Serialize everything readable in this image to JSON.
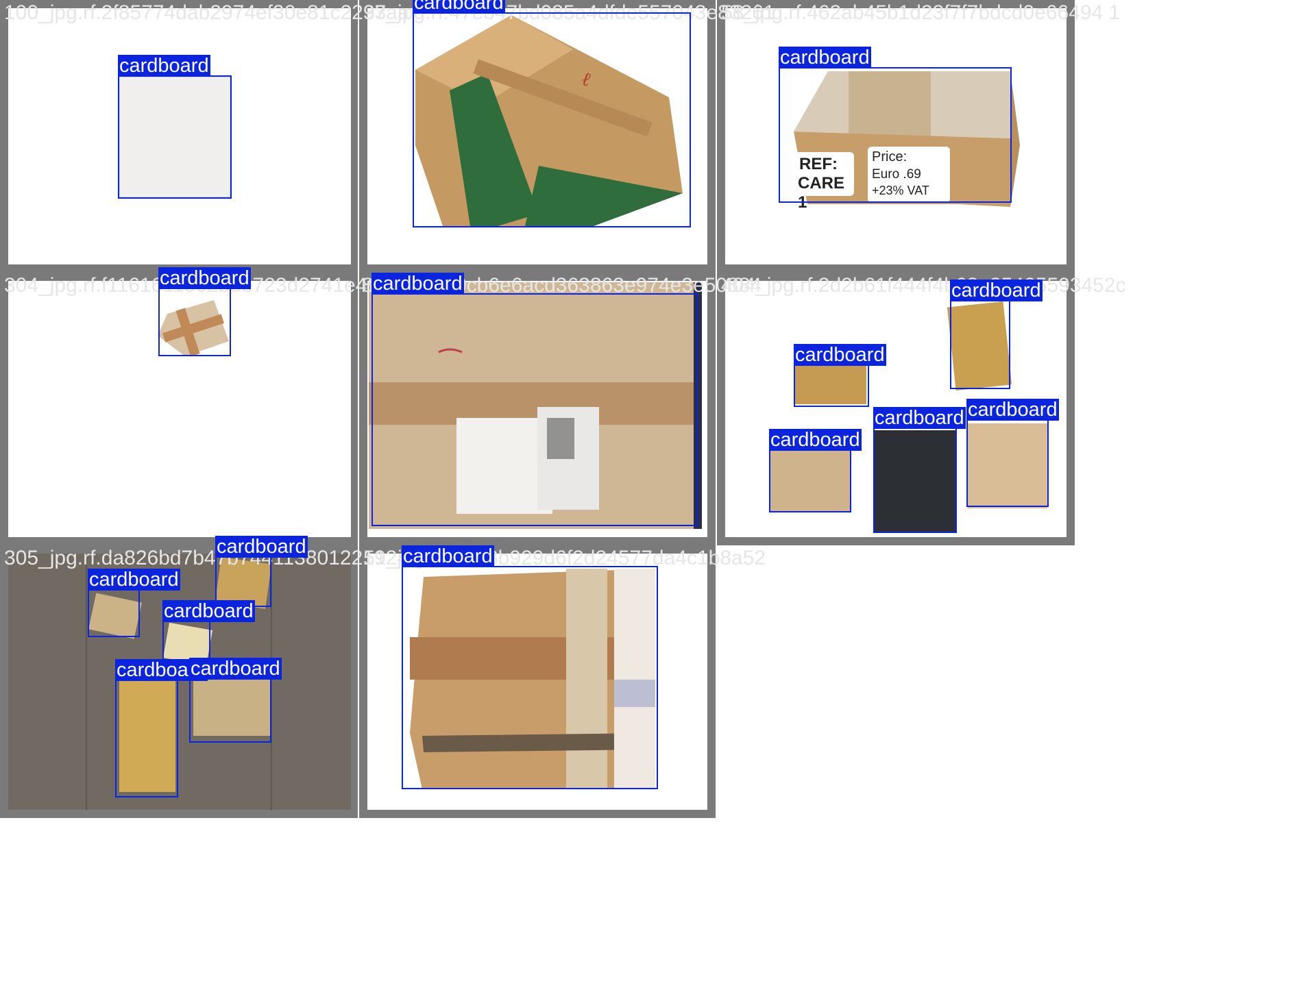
{
  "grid": {
    "tiles": [
      {
        "filename": "100_jpg.rf.2f85774dab2974ef30e81c2297aa",
        "detections": [
          {
            "label": "cardboard"
          }
        ]
      },
      {
        "filename": "33_jpg.rf.47e347bd085a4dfde557043e83261",
        "detections": [
          {
            "label": "cardboard"
          }
        ]
      },
      {
        "filename": "58_jpg.rf.462ab45b1d23f7f7bdcd0e66494 1",
        "detections": [
          {
            "label": "cardboard"
          }
        ],
        "box_text": {
          "ref": "REF:",
          "care": "CARE 1",
          "price": "Price:",
          "euro": "Euro .69",
          "vat": "+23% VAT"
        }
      },
      {
        "filename": "304_jpg.rf.f1161611002bde723d2741e41fb3c8",
        "detections": [
          {
            "label": "cardboard"
          }
        ]
      },
      {
        "filename": "8",
        "detections": [
          {
            "label": "cardboard"
          }
        ]
      },
      {
        "filename": "0cb6e6acd363863e974e3e50884",
        "detections": []
      },
      {
        "filename": "404_jpg.rf.2d2b61f444f4b68a35425593452c",
        "detections": [
          {
            "label": "cardboard"
          },
          {
            "label": "cardboard"
          },
          {
            "label": "cardboard"
          },
          {
            "label": "cardboard"
          },
          {
            "label": "cardboard"
          }
        ]
      },
      {
        "filename": "305_jpg.rf.da826bd7b47b744113801221924a",
        "detections": [
          {
            "label": "cardboard"
          },
          {
            "label": "cardboard"
          },
          {
            "label": "cardboard"
          },
          {
            "label": "cardboard"
          },
          {
            "label": "cardboard"
          }
        ]
      },
      {
        "filename": "51_jpg",
        "detections": [
          {
            "label": "cardboard"
          }
        ]
      },
      {
        "filename": "3b929d6f2d24577da4c1b8a52",
        "detections": []
      }
    ]
  },
  "colors": {
    "box": "#0a24e0",
    "label_text": "#ffffff",
    "frame": "#7a7a7a"
  }
}
